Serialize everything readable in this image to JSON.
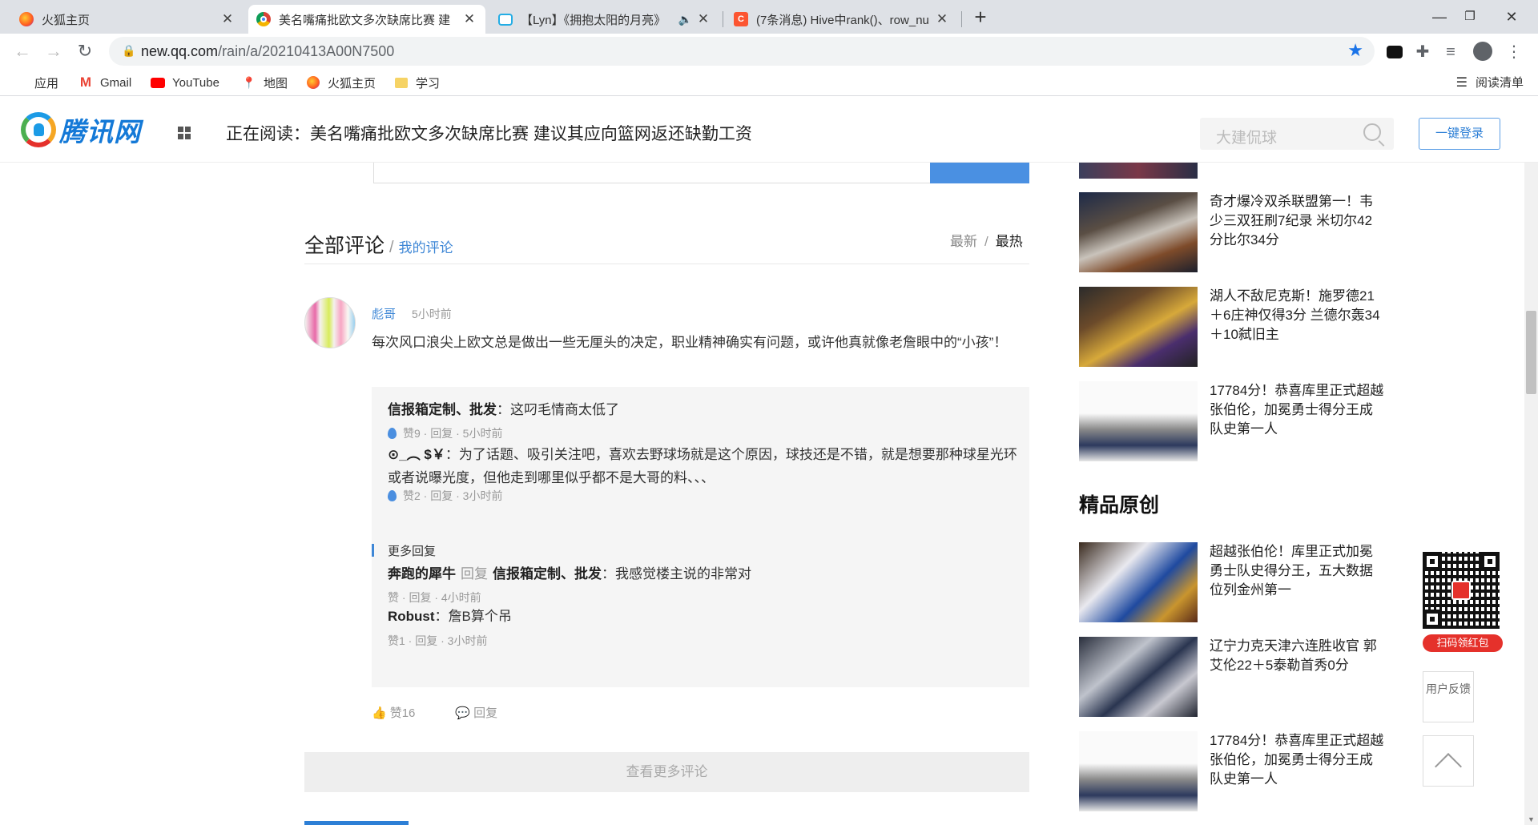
{
  "browser": {
    "tabs": [
      {
        "title": "火狐主页",
        "favicon": "firefox-icon",
        "active": false
      },
      {
        "title": "美名嘴痛批欧文多次缺席比赛 建",
        "favicon": "chrome-icon",
        "active": true
      },
      {
        "title": "【Lyn】《拥抱太阳的月亮》",
        "favicon": "bilibili-icon",
        "active": false,
        "audio": true
      },
      {
        "title": "(7条消息) Hive中rank()、row_nu",
        "favicon": "csdn-icon",
        "active": false
      }
    ],
    "url_host": "new.qq.com",
    "url_path": "/rain/a/20210413A00N7500",
    "bookmarks": [
      {
        "label": "应用",
        "icon": "apps-grid-icon"
      },
      {
        "label": "Gmail",
        "icon": "gmail-icon"
      },
      {
        "label": "YouTube",
        "icon": "youtube-icon"
      },
      {
        "label": "地图",
        "icon": "maps-pin-icon"
      },
      {
        "label": "火狐主页",
        "icon": "firefox-icon"
      },
      {
        "label": "学习",
        "icon": "folder-icon"
      }
    ],
    "reading_list": "阅读清单"
  },
  "site": {
    "logo_text": "腾讯网",
    "reading": "正在阅读：美名嘴痛批欧文多次缺席比赛 建议其应向篮网返还缺勤工资",
    "search_placeholder": "大建侃球",
    "login_label": "一键登录"
  },
  "comments": {
    "title": "全部评论",
    "separator": "/",
    "mine": "我的评论",
    "sort_latest": "最新",
    "sort_hot": "最热",
    "main": {
      "author": "彪哥",
      "time": "5小时前",
      "text": "每次风口浪尖上欧文总是做出一些无厘头的决定，职业精神确实有问题，或许他真就像老詹眼中的“小孩”！",
      "likes": "赞16",
      "reply": "回复"
    },
    "replies": [
      {
        "author": "信报箱定制、批发",
        "text": "：这叼毛情商太低了",
        "meta": "赞9 · 回复 · 5小时前"
      },
      {
        "author": "⊙_︵ $￥",
        "text": "：为了话题、吸引关注吧，喜欢去野球场就是这个原因，球技还是不错，就是想要那种球星光环或者说曝光度，但他走到哪里似乎都不是大哥的料、、、",
        "meta": "赞2 · 回复 · 3小时前"
      }
    ],
    "more_replies_label": "更多回复",
    "more_replies": [
      {
        "author": "奔跑的犀牛",
        "reply_word": "回复",
        "target": "信报箱定制、批发",
        "text": "：我感觉楼主说的非常对",
        "meta": "赞 · 回复 · 4小时前"
      },
      {
        "author": "Robust",
        "text": "：詹B算个吊",
        "meta": "赞1 · 回复 · 3小时前"
      }
    ],
    "load_more": "查看更多评论"
  },
  "sidebar": {
    "news": [
      {
        "title": "奇才爆冷双杀联盟第一！韦少三双狂刷7纪录 米切尔42分比尔34分"
      },
      {
        "title": "湖人不敌尼克斯！施罗德21＋6庄神仅得3分 兰德尔轰34＋10弑旧主"
      },
      {
        "title": "17784分！恭喜库里正式超越张伯伦，加冕勇士得分王成队史第一人"
      }
    ],
    "section_title": "精品原创",
    "originals": [
      {
        "title": "超越张伯伦！库里正式加冕勇士队史得分王，五大数据位列金州第一"
      },
      {
        "title": "辽宁力克天津六连胜收官 郭艾伦22＋5泰勒首秀0分"
      },
      {
        "title": "17784分！恭喜库里正式超越张伯伦，加冕勇士得分王成队史第一人"
      }
    ],
    "qr_label": "扫码领红包",
    "feedback": "用户反馈"
  }
}
